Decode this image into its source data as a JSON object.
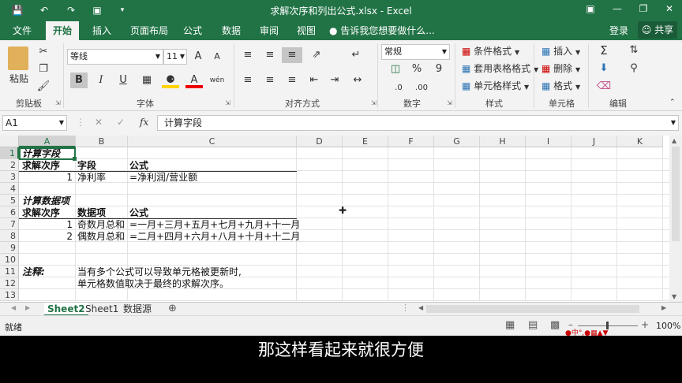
{
  "window": {
    "title": "求解次序和列出公式.xlsx - Excel"
  },
  "quick_access": [
    "save-icon",
    "undo-icon",
    "redo-icon",
    "form-icon",
    "customize-icon"
  ],
  "ribbon_tabs": [
    "文件",
    "开始",
    "插入",
    "页面布局",
    "公式",
    "数据",
    "审阅",
    "视图"
  ],
  "active_tab": "开始",
  "tell_me": "告诉我您想要做什么...",
  "login": "登录",
  "share": "共享",
  "ribbon": {
    "clipboard": {
      "paste": "粘贴",
      "label": "剪贴板"
    },
    "font": {
      "name": "等线",
      "size": "11",
      "label": "字体",
      "bold": "B",
      "italic": "I",
      "underline": "U",
      "grow": "A",
      "shrink": "A",
      "wen": "wén"
    },
    "alignment": {
      "label": "对齐方式"
    },
    "number": {
      "format": "常规",
      "percent": "%",
      "comma": "9",
      "label": "数字"
    },
    "styles": {
      "conditional": "条件格式",
      "table": "套用表格格式",
      "cell_styles": "单元格样式",
      "label": "样式"
    },
    "cells": {
      "insert": "插入",
      "delete": "删除",
      "format": "格式",
      "label": "单元格"
    },
    "editing": {
      "label": "编辑"
    }
  },
  "formula_bar": {
    "name_box": "A1",
    "fx": "fx",
    "content": "计算字段"
  },
  "columns": [
    "A",
    "B",
    "C",
    "D",
    "E",
    "F",
    "G",
    "H",
    "I",
    "J",
    "K"
  ],
  "rows": [
    "1",
    "2",
    "3",
    "4",
    "5",
    "6",
    "7",
    "8",
    "9",
    "10",
    "11",
    "12",
    "13"
  ],
  "cells": {
    "A1": "计算字段",
    "A2": "求解次序",
    "B2": "字段",
    "C2": "公式",
    "A3": "1",
    "B3": "净利率",
    "C3": "=净利润/营业额",
    "A5": "计算数据项",
    "A6": "求解次序",
    "B6": "数据项",
    "C6": "公式",
    "A7": "1",
    "B7": "奇数月总和",
    "C7": "=一月+三月+五月+七月+九月+十一月",
    "A8": "2",
    "B8": "偶数月总和",
    "C8": "=二月+四月+六月+八月+十月+十二月",
    "A11": "注释:",
    "B11": "当有多个公式可以导致单元格被更新时,",
    "B12": "单元格数值取决于最终的求解次序。"
  },
  "sheets": [
    "Sheet2",
    "Sheet1",
    "数据源"
  ],
  "active_sheet": "Sheet2",
  "status": {
    "ready": "就绪",
    "zoom": "100%"
  },
  "subtitle": "那这样看起来就很方便",
  "colors": {
    "excel_green": "#217346",
    "ribbon_bg": "#f3f3f3"
  }
}
